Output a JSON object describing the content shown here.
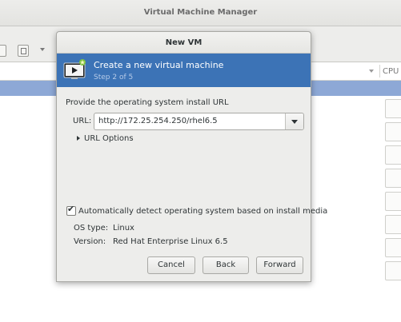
{
  "main_window": {
    "title": "Virtual Machine Manager",
    "column_cpu": "CPU"
  },
  "dialog": {
    "title": "New VM",
    "banner": {
      "title": "Create a new virtual machine",
      "step": "Step 2 of 5"
    },
    "instruction": "Provide the operating system install URL",
    "url": {
      "label": "URL:",
      "value": "http://172.25.254.250/rhel6.5"
    },
    "url_options_label": "URL Options",
    "auto_detect": {
      "label": "Automatically detect operating system based on install media",
      "checked": true
    },
    "os_type": {
      "label": "OS type:",
      "value": "Linux"
    },
    "version": {
      "label": "Version:",
      "value": "Red Hat Enterprise Linux 6.5"
    },
    "buttons": {
      "cancel": "Cancel",
      "back": "Back",
      "forward": "Forward"
    }
  },
  "colors": {
    "banner": "#3c73b6",
    "selection": "#8da8d6",
    "dialog_bg": "#ededeb"
  },
  "icons": {
    "banner": "vm-monitor-new-icon",
    "url_dropdown": "chevron-down-icon",
    "expander": "triangle-right-icon"
  }
}
